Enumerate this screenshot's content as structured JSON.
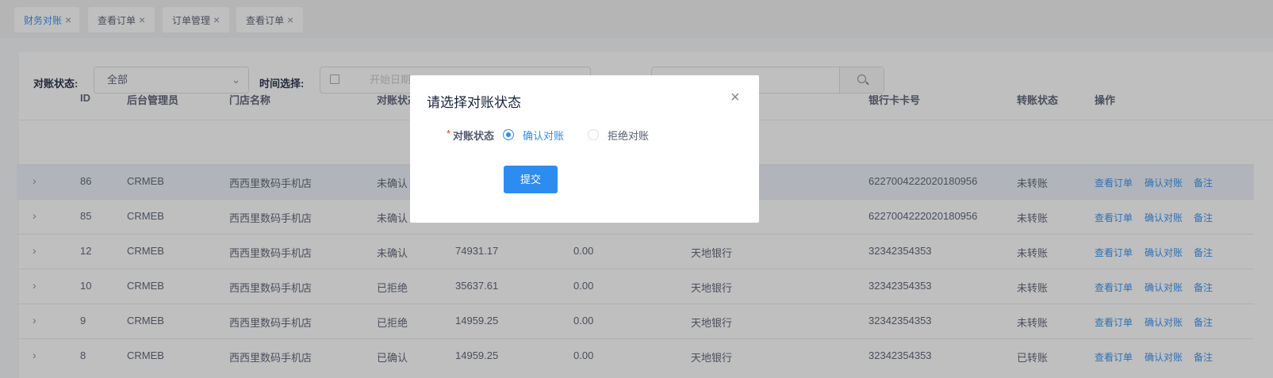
{
  "tabs": [
    {
      "label": "财务对账",
      "close": "×"
    },
    {
      "label": "查看订单",
      "close": "×"
    },
    {
      "label": "订单管理",
      "close": "×"
    },
    {
      "label": "查看订单",
      "close": "×"
    }
  ],
  "filters": {
    "status_label": "对账状态:",
    "status_value": "全部",
    "time_label": "时间选择:",
    "date_placeholder": "开始日期"
  },
  "table": {
    "headers": [
      "ID",
      "后台管理员",
      "门店名称",
      "对账状态",
      "银行卡卡号",
      "转账状态",
      "操作"
    ],
    "rows": [
      {
        "id": "86",
        "admin": "CRMEB",
        "store": "西西里数码手机店",
        "status": "未确认",
        "amount": "",
        "fee": "",
        "bank": "",
        "card": "6227004222020180956",
        "transfer": "未转账"
      },
      {
        "id": "85",
        "admin": "CRMEB",
        "store": "西西里数码手机店",
        "status": "未确认",
        "amount": "",
        "fee": "",
        "bank": "",
        "card": "6227004222020180956",
        "transfer": "未转账"
      },
      {
        "id": "12",
        "admin": "CRMEB",
        "store": "西西里数码手机店",
        "status": "未确认",
        "amount": "74931.17",
        "fee": "0.00",
        "bank": "天地银行",
        "card": "32342354353",
        "transfer": "未转账"
      },
      {
        "id": "10",
        "admin": "CRMEB",
        "store": "西西里数码手机店",
        "status": "已拒绝",
        "amount": "35637.61",
        "fee": "0.00",
        "bank": "天地银行",
        "card": "32342354353",
        "transfer": "未转账"
      },
      {
        "id": "9",
        "admin": "CRMEB",
        "store": "西西里数码手机店",
        "status": "已拒绝",
        "amount": "14959.25",
        "fee": "0.00",
        "bank": "天地银行",
        "card": "32342354353",
        "transfer": "未转账"
      },
      {
        "id": "8",
        "admin": "CRMEB",
        "store": "西西里数码手机店",
        "status": "已确认",
        "amount": "14959.25",
        "fee": "0.00",
        "bank": "天地银行",
        "card": "32342354353",
        "transfer": "已转账"
      }
    ],
    "actions": {
      "view": "查看订单",
      "confirm": "确认对账",
      "note": "备注"
    }
  },
  "modal": {
    "title": "请选择对账状态",
    "close": "×",
    "required_mark": "*",
    "field_label": "对账状态",
    "options": [
      {
        "label": "确认对账",
        "checked": true
      },
      {
        "label": "拒绝对账",
        "checked": false
      }
    ],
    "submit": "提交"
  }
}
